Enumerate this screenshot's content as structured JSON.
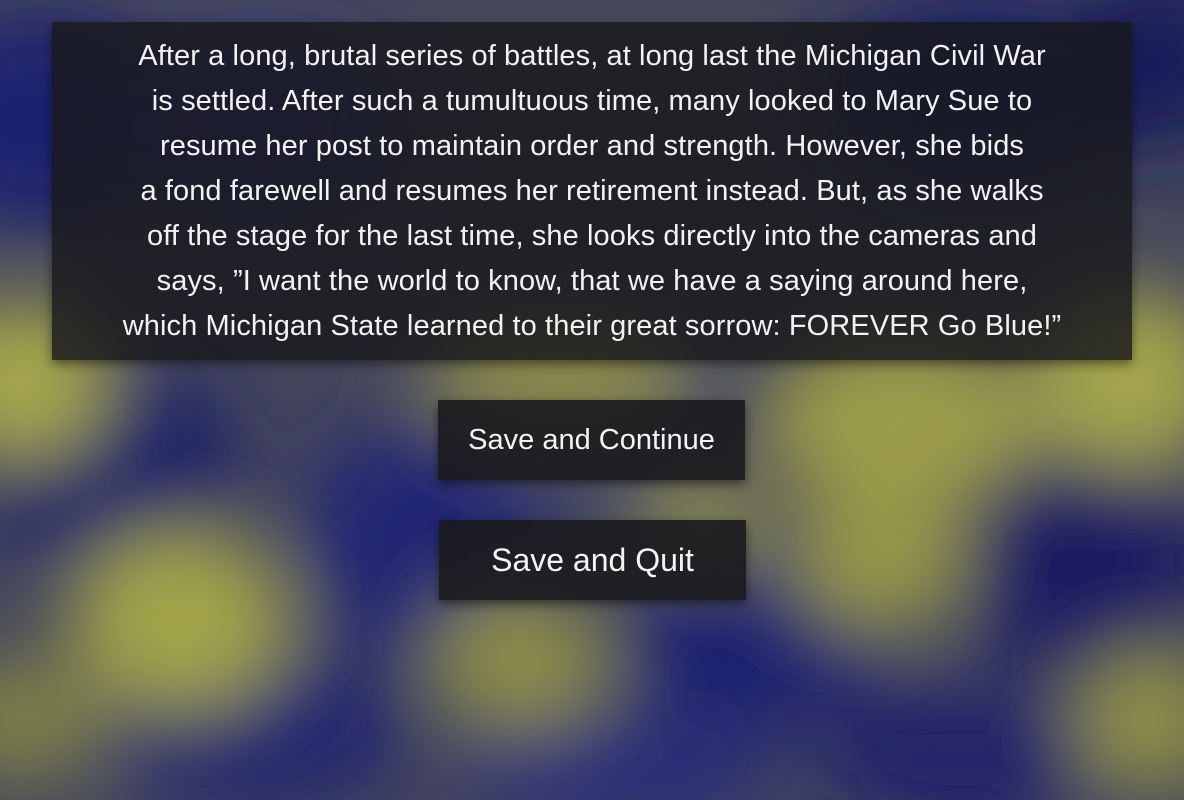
{
  "story": {
    "text": "After a long, brutal series of battles, at long last the Michigan Civil War\nis settled. After such a tumultuous time, many looked to Mary Sue to\nresume her post to maintain order and strength. However, she bids\na fond farewell and resumes her retirement instead. But, as she walks\noff the stage for the last time, she looks directly into the cameras and\nsays, ”I want the world to know, that we have a saying around here,\nwhich Michigan State learned to their great sorrow: FOREVER Go Blue!”"
  },
  "menu": {
    "save_continue_label": "Save and Continue",
    "save_quit_label": "Save and Quit"
  },
  "colors": {
    "background_blue": "#2a2d6a",
    "background_yellow": "#9a9c48",
    "panel": "#18181c",
    "text": "#f2f2f2"
  }
}
